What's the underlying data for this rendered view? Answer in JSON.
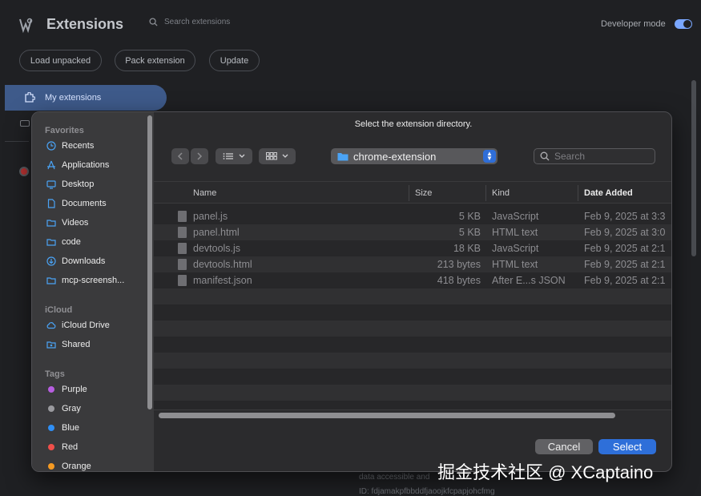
{
  "extensions_page": {
    "title": "Extensions",
    "search_placeholder": "Search extensions",
    "developer_mode_label": "Developer mode",
    "buttons": [
      "Load unpacked",
      "Pack extension",
      "Update"
    ],
    "nav_active": "My extensions",
    "bg_text_1": "data accessible and",
    "bg_text_2": "ID: fdjamakpfbbddfjaoojkfcpapjohcfmg"
  },
  "dialog": {
    "title": "Select the extension directory.",
    "sidebar": {
      "favorites_header": "Favorites",
      "favorites": [
        "Recents",
        "Applications",
        "Desktop",
        "Documents",
        "Videos",
        "code",
        "Downloads",
        "mcp-screensh..."
      ],
      "icloud_header": "iCloud",
      "icloud": [
        "iCloud Drive",
        "Shared"
      ],
      "tags_header": "Tags",
      "tags": [
        {
          "label": "Purple",
          "color": "#b75ee0"
        },
        {
          "label": "Gray",
          "color": "#9a9a9e"
        },
        {
          "label": "Blue",
          "color": "#2f8ff5"
        },
        {
          "label": "Red",
          "color": "#f04f4a"
        },
        {
          "label": "Orange",
          "color": "#f59a22"
        }
      ]
    },
    "path": "chrome-extension",
    "search_placeholder": "Search",
    "columns": {
      "name": "Name",
      "size": "Size",
      "kind": "Kind",
      "date": "Date Added"
    },
    "files": [
      {
        "name": "panel.js",
        "size": "5 KB",
        "kind": "JavaScript",
        "date": "Feb 9, 2025 at 3:3"
      },
      {
        "name": "panel.html",
        "size": "5 KB",
        "kind": "HTML text",
        "date": "Feb 9, 2025 at 3:0"
      },
      {
        "name": "devtools.js",
        "size": "18 KB",
        "kind": "JavaScript",
        "date": "Feb 9, 2025 at 2:1"
      },
      {
        "name": "devtools.html",
        "size": "213 bytes",
        "kind": "HTML text",
        "date": "Feb 9, 2025 at 2:1"
      },
      {
        "name": "manifest.json",
        "size": "418 bytes",
        "kind": "After E...s JSON",
        "date": "Feb 9, 2025 at 2:1"
      }
    ],
    "cancel_label": "Cancel",
    "select_label": "Select"
  },
  "watermark": "掘金技术社区 @ XCaptaino",
  "colors": {
    "accent": "#2e6fd9",
    "nav_active": "#3e5a8a",
    "folder": "#4aa3f5"
  }
}
